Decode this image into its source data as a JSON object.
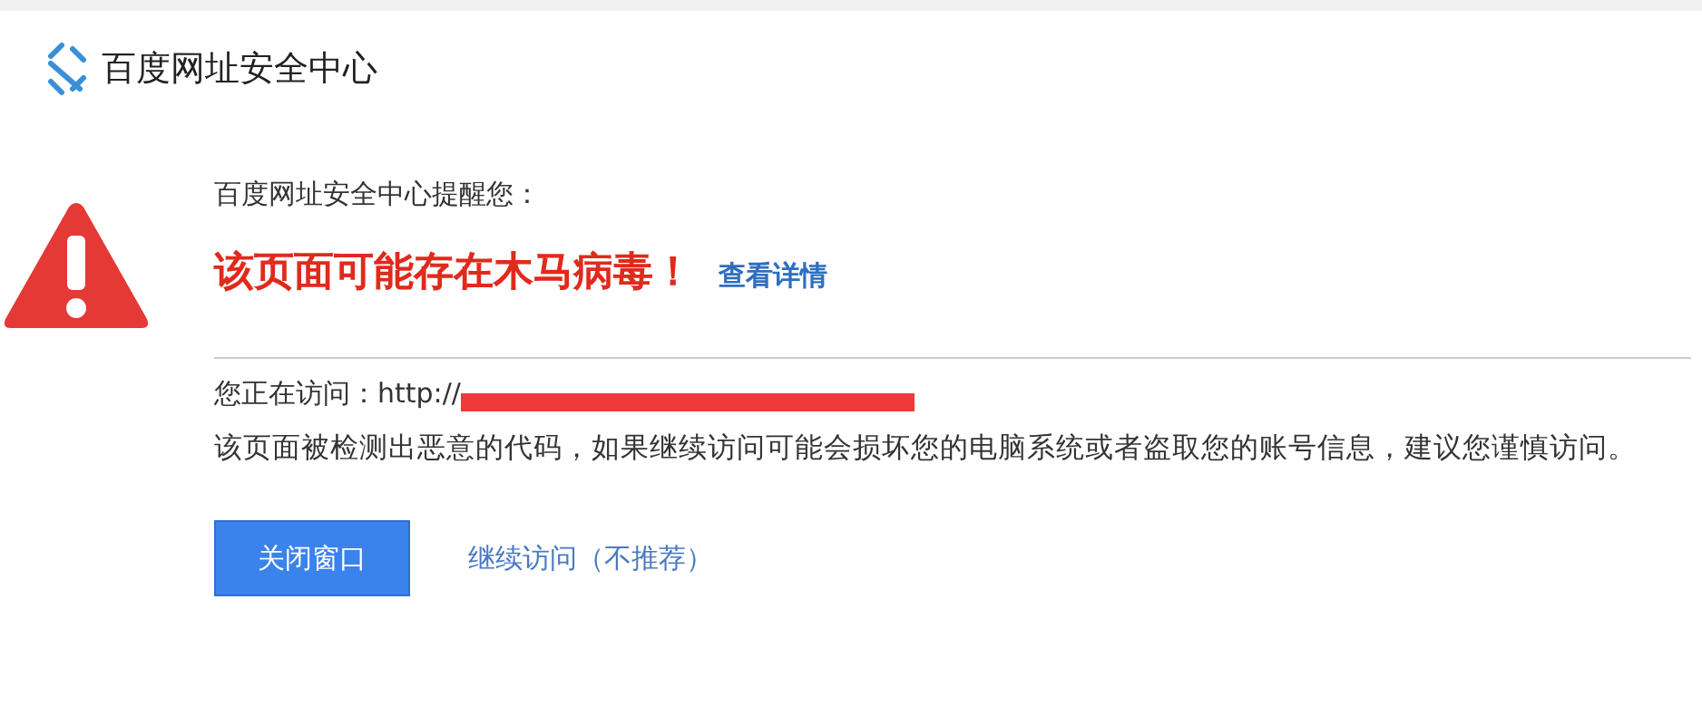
{
  "header": {
    "title": "百度网址安全中心"
  },
  "warning": {
    "intro": "百度网址安全中心提醒您：",
    "headline": "该页面可能存在木马病毒！",
    "details_link": "查看详情"
  },
  "visit": {
    "label": "您正在访问：http://",
    "redacted": true,
    "message": "该页面被检测出恶意的代码，如果继续访问可能会损坏您的电脑系统或者盗取您的账号信息，建议您谨慎访问。"
  },
  "buttons": {
    "close": "关闭窗口",
    "continue": "继续访问（不推荐）"
  }
}
